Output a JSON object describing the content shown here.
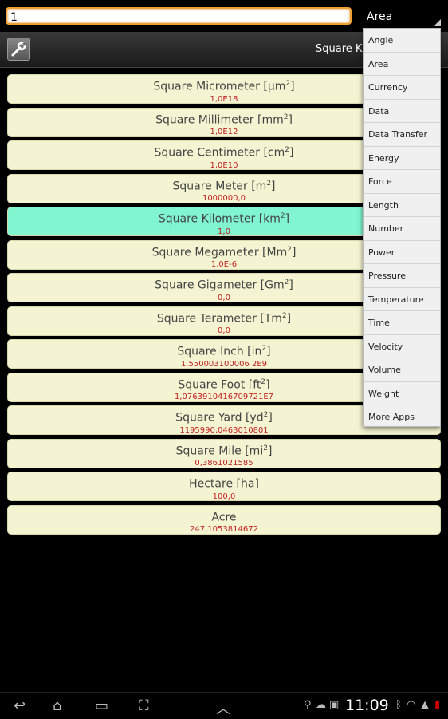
{
  "input": {
    "value": "1"
  },
  "category": {
    "selected": "Area"
  },
  "toolbar": {
    "selected_unit_partial": "Square Ki"
  },
  "units": [
    {
      "name": "Square Micrometer [μm",
      "sup": "2",
      "close": "]",
      "value": "1,0E18"
    },
    {
      "name": "Square Millimeter [mm",
      "sup": "2",
      "close": "]",
      "value": "1,0E12"
    },
    {
      "name": "Square Centimeter [cm",
      "sup": "2",
      "close": "]",
      "value": "1,0E10"
    },
    {
      "name": "Square Meter [m",
      "sup": "2",
      "close": "]",
      "value": "1000000,0"
    },
    {
      "name": "Square Kilometer [km",
      "sup": "2",
      "close": "]",
      "value": "1,0"
    },
    {
      "name": "Square Megameter [Mm",
      "sup": "2",
      "close": "]",
      "value": "1,0E-6"
    },
    {
      "name": "Square Gigameter [Gm",
      "sup": "2",
      "close": "]",
      "value": "0,0"
    },
    {
      "name": "Square Terameter [Tm",
      "sup": "2",
      "close": "]",
      "value": "0,0"
    },
    {
      "name": "Square Inch [in",
      "sup": "2",
      "close": "]",
      "value": "1,550003100006 2E9"
    },
    {
      "name": "Square Foot [ft",
      "sup": "2",
      "close": "]",
      "value": "1,0763910416709721E7"
    },
    {
      "name": "Square Yard [yd",
      "sup": "2",
      "close": "]",
      "value": "1195990,0463010801"
    },
    {
      "name": "Square Mile [mi",
      "sup": "2",
      "close": "]",
      "value": "0,3861021585"
    },
    {
      "name": "Hectare [ha",
      "sup": "",
      "close": "]",
      "value": "100,0"
    },
    {
      "name": "Acre",
      "sup": "",
      "close": "",
      "value": "247,1053814672"
    }
  ],
  "dropdown": {
    "items": [
      "Angle",
      "Area",
      "Currency",
      "Data",
      "Data Transfer",
      "Energy",
      "Force",
      "Length",
      "Number",
      "Power",
      "Pressure",
      "Temperature",
      "Time",
      "Velocity",
      "Volume",
      "Weight",
      "More Apps"
    ]
  },
  "statusbar": {
    "time": "11:09"
  }
}
